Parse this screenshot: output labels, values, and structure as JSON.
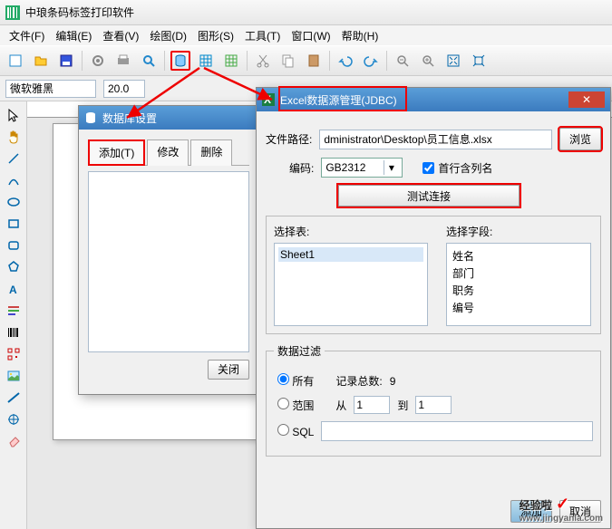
{
  "app": {
    "title": "中琅条码标签打印软件"
  },
  "menu": {
    "file": "文件(F)",
    "edit": "编辑(E)",
    "view": "查看(V)",
    "draw": "绘图(D)",
    "shape": "图形(S)",
    "tool": "工具(T)",
    "window": "窗口(W)",
    "help": "帮助(H)"
  },
  "format": {
    "font": "微软雅黑",
    "size": "20.0"
  },
  "db_dialog": {
    "title": "数据库设置",
    "tab_add": "添加(T)",
    "tab_modify": "修改",
    "tab_delete": "删除",
    "close": "关闭"
  },
  "excel_dialog": {
    "title": "Excel数据源管理(JDBC)",
    "path_label": "文件路径:",
    "path_value": "dministrator\\Desktop\\员工信息.xlsx",
    "browse": "浏览",
    "encoding_label": "编码:",
    "encoding_value": "GB2312",
    "firstrow": "首行含列名",
    "test": "测试连接",
    "select_table": "选择表:",
    "select_field": "选择字段:",
    "tables": [
      "Sheet1"
    ],
    "fields": [
      "姓名",
      "部门",
      "职务",
      "编号"
    ],
    "filter_legend": "数据过滤",
    "filter_all": "所有",
    "filter_range": "范围",
    "filter_sql": "SQL",
    "total_label": "记录总数:",
    "total_value": "9",
    "from": "从",
    "to": "到",
    "from_v": "1",
    "to_v": "1",
    "add": "添加",
    "cancel": "取消"
  },
  "watermark": {
    "text": "经验啦",
    "url": "www.jingyanla.com"
  }
}
